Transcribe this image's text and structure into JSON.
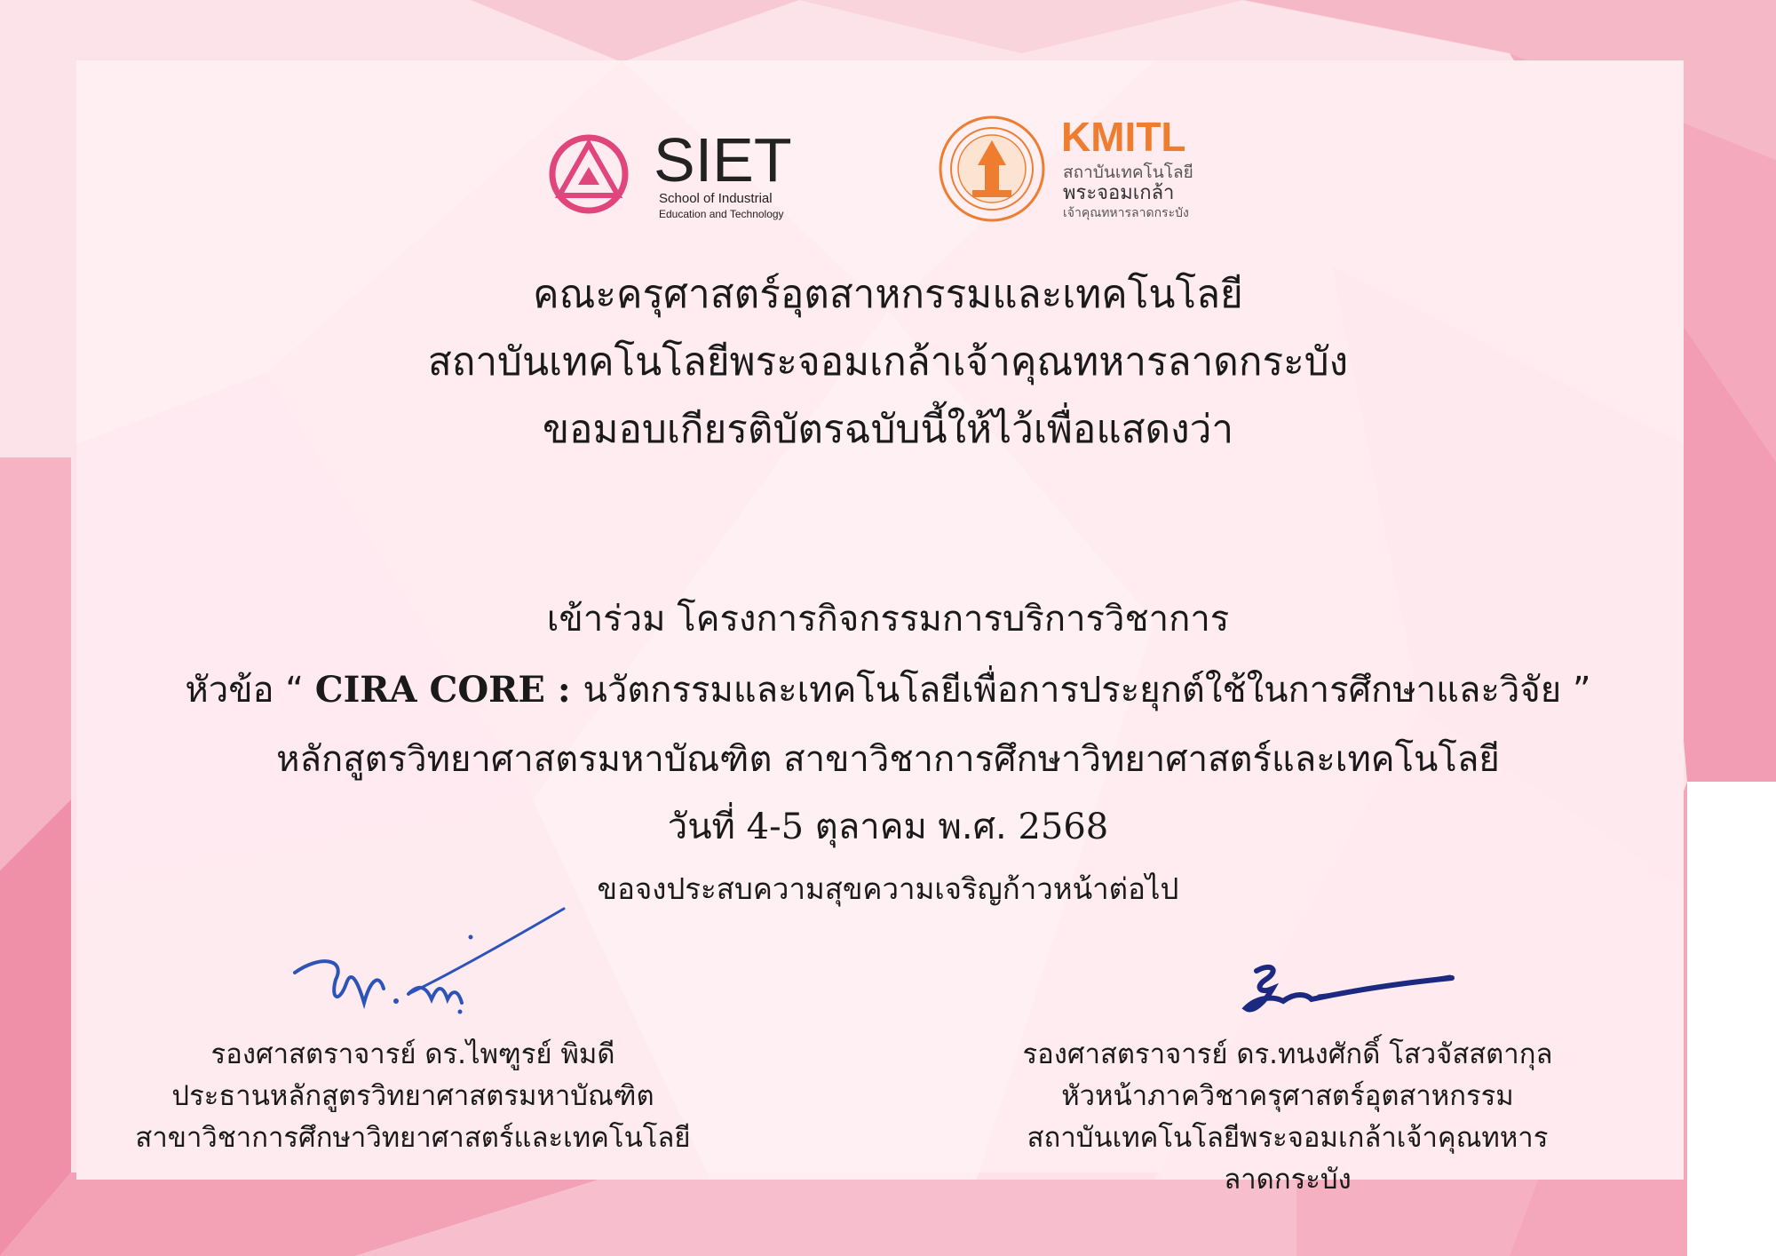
{
  "logos": {
    "siet": {
      "abbr": "SIET",
      "line1": "School of Industrial",
      "line2": "Education and Technology",
      "color": "#e0457b"
    },
    "kmitl": {
      "abbr": "KMITL",
      "line1": "สถาบันเทคโนโลยี",
      "line2": "พระจอมเกล้า",
      "line3": "เจ้าคุณทหารลาดกระบัง",
      "color": "#ef7d2f"
    }
  },
  "header": {
    "line1": "คณะครุศาสตร์อุตสาหกรรมและเทคโนโลยี",
    "line2": "สถาบันเทคโนโลยีพระจอมเกล้าเจ้าคุณทหารลาดกระบัง",
    "line3": "ขอมอบเกียรติบัตรฉบับนี้ให้ไว้เพื่อแสดงว่า"
  },
  "body": {
    "participation": "เข้าร่วม  โครงการกิจกรรมการบริการวิชาการ",
    "topic_prefix": "หัวข้อ  “ ",
    "topic_title": "CIRA CORE : ",
    "topic_rest": "นวัตกรรมและเทคโนโลยีเพื่อการประยุกต์ใช้ในการศึกษาและวิจัย ”",
    "program": "หลักสูตรวิทยาศาสตรมหาบัณฑิต สาขาวิชาการศึกษาวิทยาศาสตร์และเทคโนโลยี",
    "date_prefix": "วันที่ ",
    "date_days": "4-5",
    "date_month": " ตุลาคม พ.ศ. ",
    "date_year": "2568",
    "wish": "ขอจงประสบความสุขความเจริญก้าวหน้าต่อไป"
  },
  "signatures": {
    "left": {
      "name": "รองศาสตราจารย์  ดร.ไพฑูรย์  พิมดี",
      "position1": "ประธานหลักสูตรวิทยาศาสตรมหาบัณฑิต",
      "position2": "สาขาวิชาการศึกษาวิทยาศาสตร์และเทคโนโลยี"
    },
    "right": {
      "name": "รองศาสตราจารย์  ดร.ทนงศักดิ์ โสวจัสสตากุล",
      "position1": "หัวหน้าภาควิชาครุศาสตร์อุตสาหกรรม",
      "position2": "สถาบันเทคโนโลยีพระจอมเกล้าเจ้าคุณทหารลาดกระบัง"
    }
  }
}
